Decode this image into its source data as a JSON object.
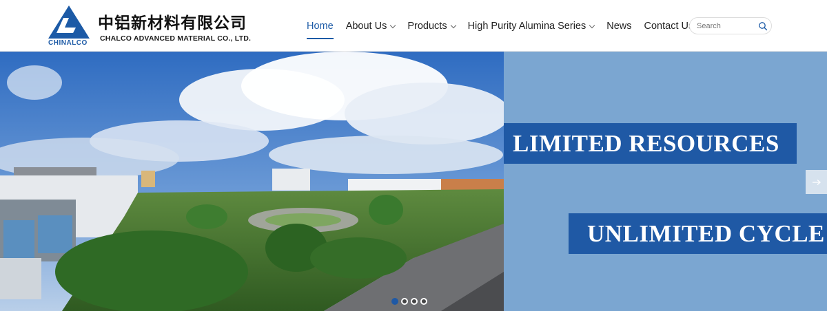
{
  "brand": {
    "name_zh": "中铝新材料有限公司",
    "name_en": "CHALCO ADVANCED MATERIAL CO., LTD.",
    "logo_word": "CHINALCO",
    "color": "#1c5aa6"
  },
  "nav": {
    "items": [
      {
        "label": "Home",
        "dropdown": false,
        "active": true
      },
      {
        "label": "About Us",
        "dropdown": true,
        "active": false
      },
      {
        "label": "Products",
        "dropdown": true,
        "active": false
      },
      {
        "label": "High Purity Alumina Series",
        "dropdown": true,
        "active": false
      },
      {
        "label": "News",
        "dropdown": false,
        "active": false
      },
      {
        "label": "Contact Us",
        "dropdown": false,
        "active": false
      }
    ]
  },
  "search": {
    "placeholder": "Search",
    "icon": "search-icon"
  },
  "hero": {
    "slogan_1": "LIMITED RESOURCES",
    "slogan_2": "UNLIMITED CYCLE",
    "panel_color": "#7ba6d1",
    "banner_color": "#1f59a5",
    "next_icon": "arrow-right-icon",
    "slides": 4,
    "active_slide": 1
  }
}
